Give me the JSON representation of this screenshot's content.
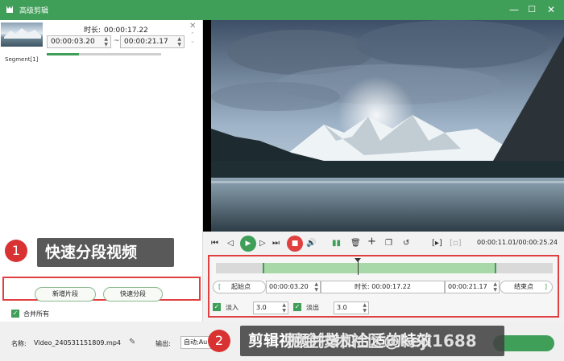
{
  "window": {
    "title": "高级剪辑",
    "minimize": "—",
    "maximize": "☐",
    "close": "✕"
  },
  "segment": {
    "label": "Segment[1]",
    "duration_label": "时长:",
    "duration": "00:00:17.22",
    "start": "00:00:03.20",
    "end": "00:00:21.17",
    "tilde": "~",
    "progress": 0.28
  },
  "left": {
    "new_segment": "新增片段",
    "quick_split": "快速分段",
    "merge_all": "合并所有"
  },
  "callouts": [
    {
      "num": "1",
      "text": "快速分段视频"
    },
    {
      "num": "2",
      "text": "剪辑视频并增加合适的特效"
    }
  ],
  "player": {
    "timecode": "00:00:11.01/00:00:25.24",
    "playhead": 0.42,
    "selection_start": 0.138,
    "selection_end": 0.832
  },
  "edit": {
    "start_label": "起始点",
    "start_time": "00:00:03.20",
    "duration_label": "时长:",
    "duration": "00:00:17.22",
    "end_time": "00:00:21.17",
    "end_label": "结束点",
    "fade_in_label": "淡入",
    "fade_in": "3.0",
    "fade_out_label": "淡出",
    "fade_out": "3.0"
  },
  "bottom": {
    "name_label": "名称:",
    "filename": "Video_240531151809.mp4",
    "output_label": "输出:",
    "output_value": "自动;Au"
  },
  "watermark": "掘金技术社区@keji1688",
  "colors": {
    "accent": "#3f9e58",
    "highlight": "#e04040"
  }
}
